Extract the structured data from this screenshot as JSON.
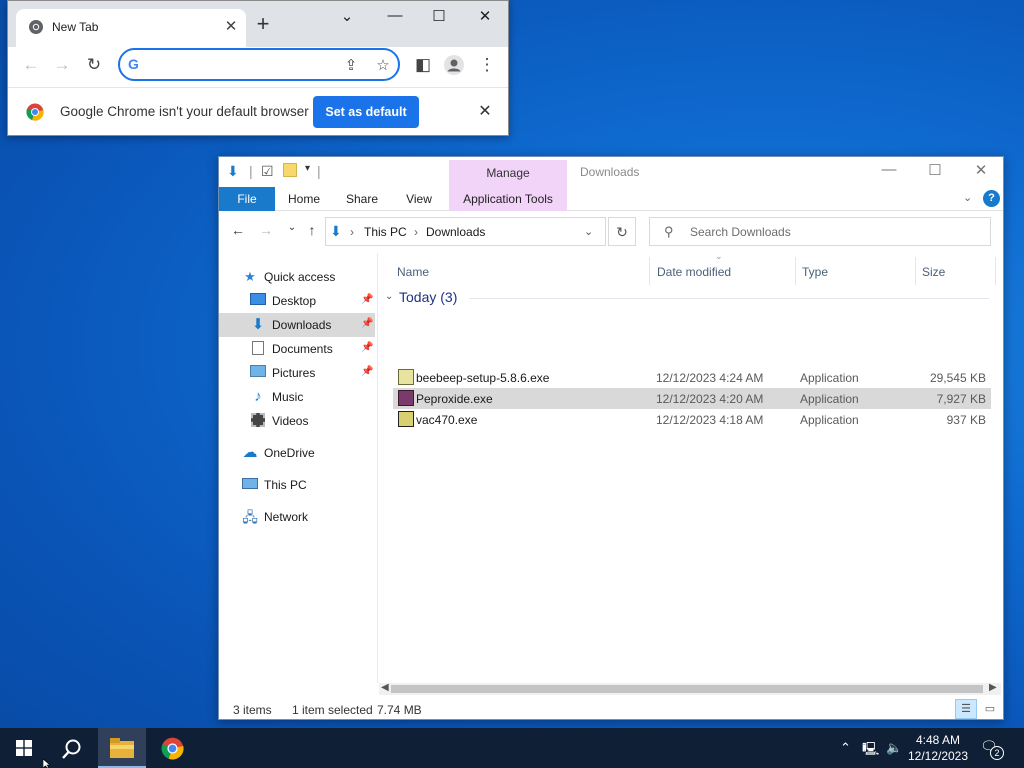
{
  "chrome": {
    "tab_title": "New Tab",
    "omnibox_value": "",
    "infobar_message": "Google Chrome isn't your default browser",
    "set_default_label": "Set as default"
  },
  "explorer": {
    "window_title": "Downloads",
    "ribbon": {
      "context_group": "Manage",
      "tabs": [
        "File",
        "Home",
        "Share",
        "View",
        "Application Tools"
      ]
    },
    "address": {
      "segments": [
        "This PC",
        "Downloads"
      ]
    },
    "search_placeholder": "Search Downloads",
    "nav": [
      {
        "label": "Quick access",
        "icon": "star-icon"
      },
      {
        "label": "Desktop",
        "icon": "desktop-icon",
        "pinned": true
      },
      {
        "label": "Downloads",
        "icon": "download-arrow-icon",
        "pinned": true,
        "selected": true
      },
      {
        "label": "Documents",
        "icon": "documents-icon",
        "pinned": true
      },
      {
        "label": "Pictures",
        "icon": "pictures-icon",
        "pinned": true
      },
      {
        "label": "Music",
        "icon": "music-icon"
      },
      {
        "label": "Videos",
        "icon": "videos-icon"
      },
      {
        "label": "OneDrive",
        "icon": "cloud-icon"
      },
      {
        "label": "This PC",
        "icon": "computer-icon"
      },
      {
        "label": "Network",
        "icon": "network-icon"
      }
    ],
    "columns": [
      "Name",
      "Date modified",
      "Type",
      "Size"
    ],
    "group_label": "Today (3)",
    "files": [
      {
        "name": "beebeep-setup-5.8.6.exe",
        "date": "12/12/2023 4:24 AM",
        "type": "Application",
        "size": "29,545 KB"
      },
      {
        "name": "Peproxide.exe",
        "date": "12/12/2023 4:20 AM",
        "type": "Application",
        "size": "7,927 KB",
        "selected": true
      },
      {
        "name": "vac470.exe",
        "date": "12/12/2023 4:18 AM",
        "type": "Application",
        "size": "937 KB"
      }
    ],
    "status": {
      "items": "3 items",
      "selected": "1 item selected",
      "size": "7.74 MB"
    }
  },
  "taskbar": {
    "time": "4:48 AM",
    "date": "12/12/2023",
    "notification_count": "2"
  },
  "colors": {
    "accent": "#1979ca",
    "chrome_blue": "#1a73e8",
    "context_tab": "#f1d4f8",
    "taskbar": "#0f1f36"
  }
}
